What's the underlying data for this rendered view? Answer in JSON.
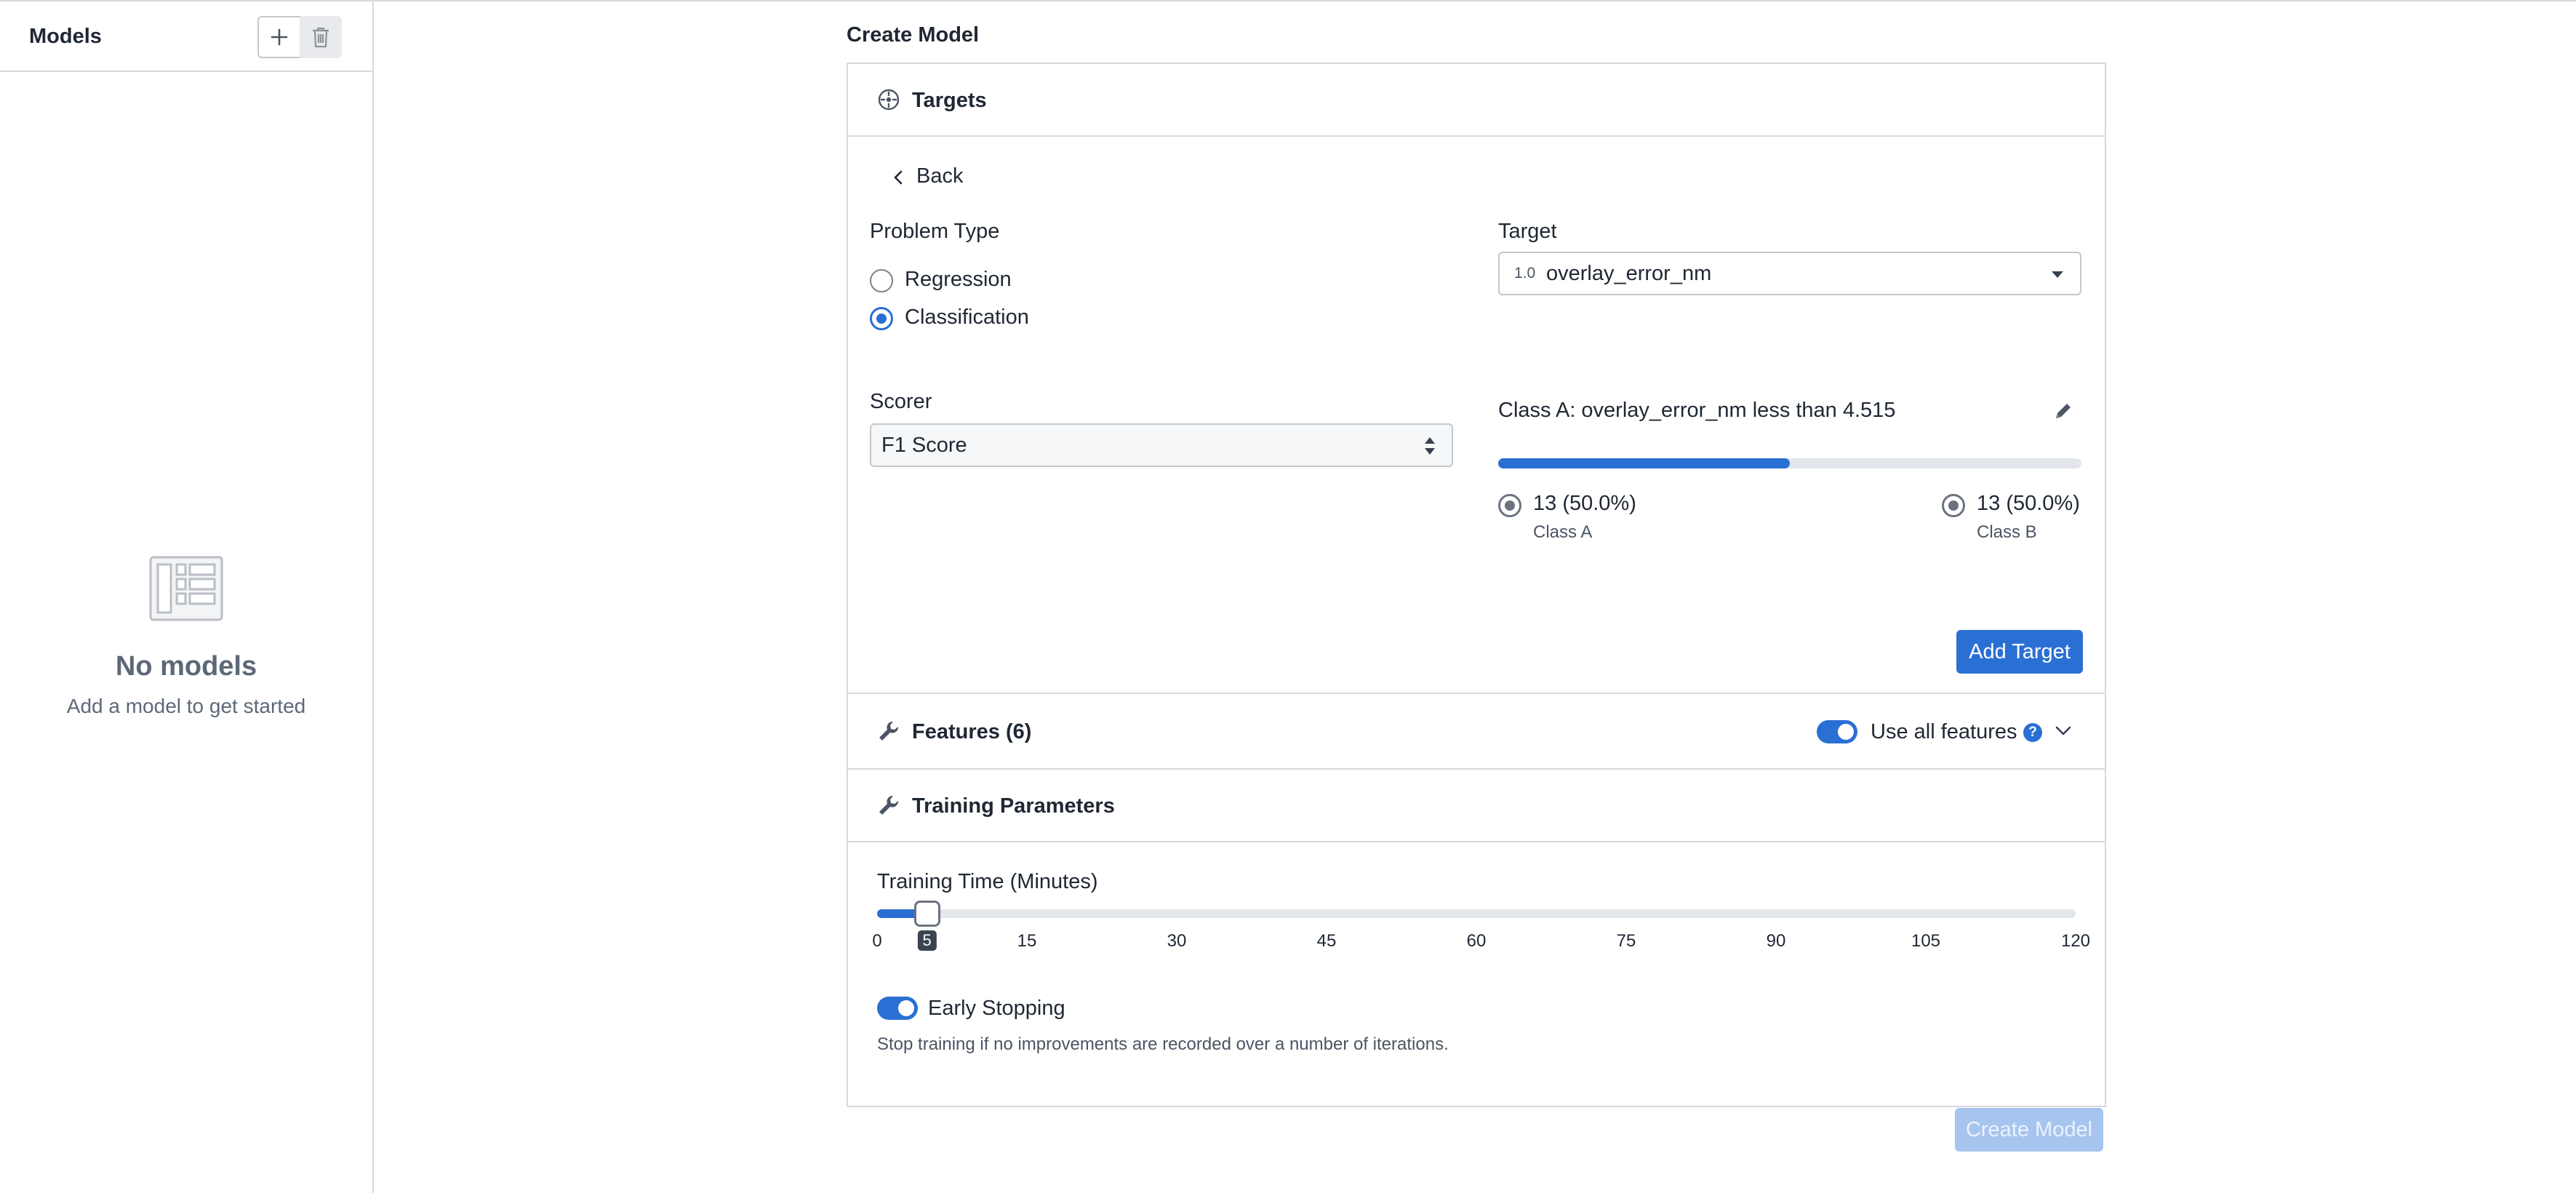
{
  "sidebar": {
    "title": "Models",
    "empty_title": "No models",
    "empty_subtitle": "Add a model to get started"
  },
  "page_title": "Create Model",
  "targets": {
    "header": "Targets",
    "back_label": "Back",
    "problem_type_label": "Problem Type",
    "options": [
      {
        "label": "Regression",
        "checked": false
      },
      {
        "label": "Classification",
        "checked": true
      }
    ],
    "target_label": "Target",
    "target_prefix": "1.0",
    "target_value": "overlay_error_nm",
    "scorer_label": "Scorer",
    "scorer_value": "F1 Score",
    "class_rule": "Class A: overlay_error_nm less than 4.515",
    "split_fraction": 0.5,
    "class_a": {
      "count": "13 (50.0%)",
      "name": "Class A"
    },
    "class_b": {
      "count": "13 (50.0%)",
      "name": "Class B"
    },
    "add_target_label": "Add Target"
  },
  "features": {
    "header": "Features (6)",
    "use_all_label": "Use all features",
    "use_all_on": true
  },
  "training": {
    "header": "Training Parameters",
    "time_label": "Training Time (Minutes)",
    "time_value": 5,
    "time_min": 0,
    "time_max": 120,
    "ticks": [
      "0",
      "5",
      "15",
      "30",
      "45",
      "60",
      "75",
      "90",
      "105",
      "120"
    ],
    "early_stopping_label": "Early Stopping",
    "early_stopping_on": true,
    "early_stopping_desc": "Stop training if no improvements are recorded over a number of iterations."
  },
  "create_model_label": "Create Model",
  "colors": {
    "accent": "#2a6fd4",
    "accent_disabled": "#a6c5ee",
    "border": "#d6d9de",
    "muted_text": "#5d6877"
  }
}
